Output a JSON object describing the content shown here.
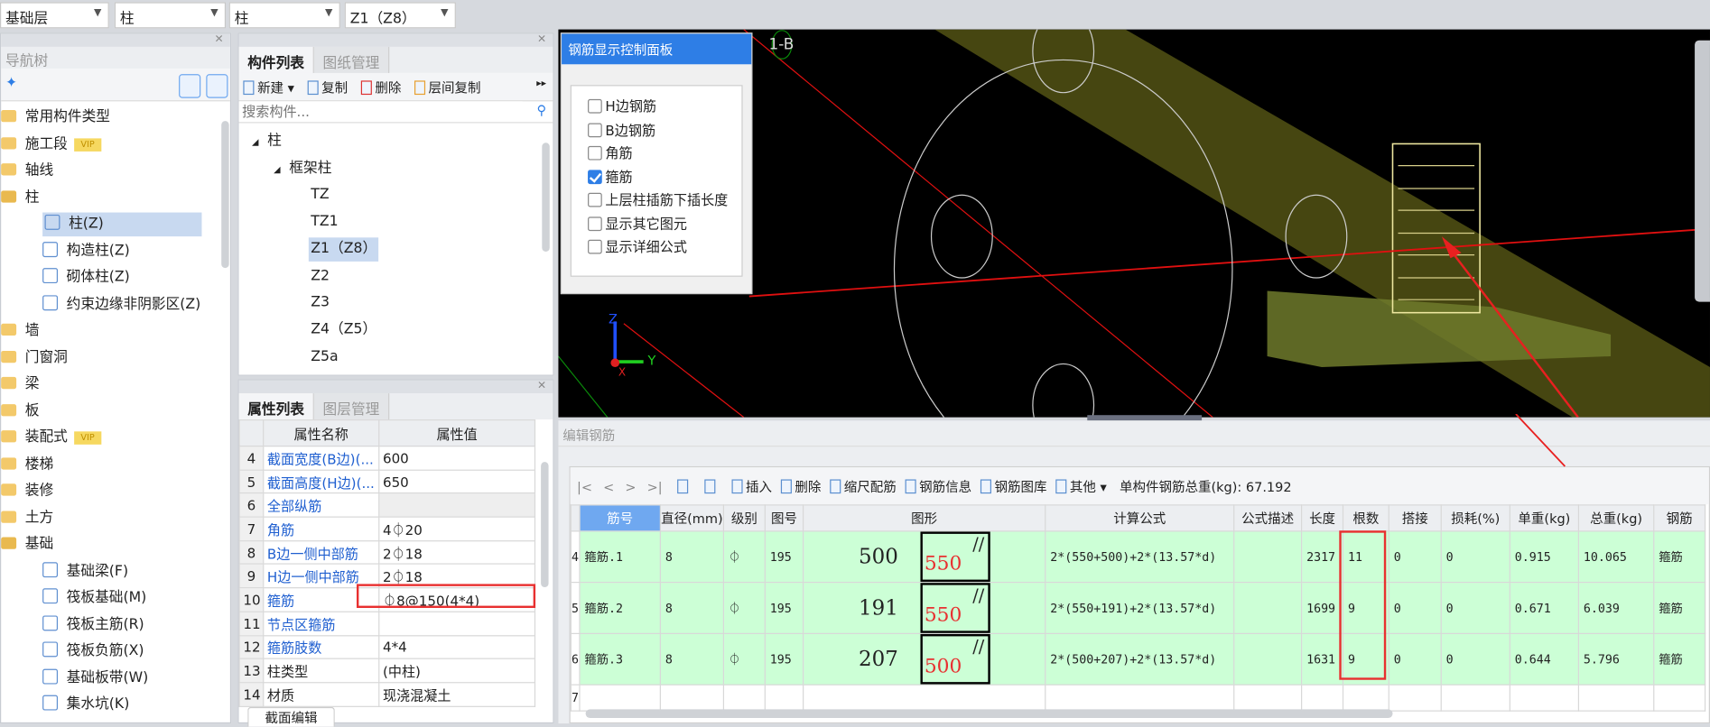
{
  "topbar": {
    "dropdowns": [
      "基础层",
      "柱",
      "柱",
      "Z1（Z8）"
    ]
  },
  "nav": {
    "title": "导航树",
    "items": [
      {
        "label": "常用构件类型",
        "type": "folder"
      },
      {
        "label": "施工段",
        "type": "folder",
        "badge": "VIP"
      },
      {
        "label": "轴线",
        "type": "folder"
      },
      {
        "label": "柱",
        "type": "folder-open"
      },
      {
        "label": "柱(Z)",
        "type": "child",
        "selected": true
      },
      {
        "label": "构造柱(Z)",
        "type": "child"
      },
      {
        "label": "砌体柱(Z)",
        "type": "child"
      },
      {
        "label": "约束边缘非阴影区(Z)",
        "type": "child"
      },
      {
        "label": "墙",
        "type": "folder"
      },
      {
        "label": "门窗洞",
        "type": "folder"
      },
      {
        "label": "梁",
        "type": "folder"
      },
      {
        "label": "板",
        "type": "folder"
      },
      {
        "label": "装配式",
        "type": "folder",
        "badge": "VIP"
      },
      {
        "label": "楼梯",
        "type": "folder"
      },
      {
        "label": "装修",
        "type": "folder"
      },
      {
        "label": "土方",
        "type": "folder"
      },
      {
        "label": "基础",
        "type": "folder-open"
      },
      {
        "label": "基础梁(F)",
        "type": "child"
      },
      {
        "label": "筏板基础(M)",
        "type": "child"
      },
      {
        "label": "筏板主筋(R)",
        "type": "child"
      },
      {
        "label": "筏板负筋(X)",
        "type": "child"
      },
      {
        "label": "基础板带(W)",
        "type": "child"
      },
      {
        "label": "集水坑(K)",
        "type": "child"
      }
    ]
  },
  "components": {
    "tabs": [
      "构件列表",
      "图纸管理"
    ],
    "toolbar": [
      "新建",
      "复制",
      "删除",
      "层间复制"
    ],
    "search_placeholder": "搜索构件...",
    "tree": [
      {
        "label": "柱",
        "level": 0
      },
      {
        "label": "框架柱",
        "level": 1
      },
      {
        "label": "TZ",
        "level": 2
      },
      {
        "label": "TZ1",
        "level": 2
      },
      {
        "label": "Z1（Z8）",
        "level": 2,
        "selected": true
      },
      {
        "label": "Z2",
        "level": 2
      },
      {
        "label": "Z3",
        "level": 2
      },
      {
        "label": "Z4（Z5）",
        "level": 2
      },
      {
        "label": "Z5a",
        "level": 2
      }
    ]
  },
  "properties": {
    "tabs": [
      "属性列表",
      "图层管理"
    ],
    "headers": [
      "属性名称",
      "属性值"
    ],
    "rows": [
      [
        "4",
        "截面宽度(B边)(...",
        "600"
      ],
      [
        "5",
        "截面高度(H边)(...",
        "650"
      ],
      [
        "6",
        "全部纵筋",
        ""
      ],
      [
        "7",
        "角筋",
        "4⏀20"
      ],
      [
        "8",
        "B边一侧中部筋",
        "2⏀18"
      ],
      [
        "9",
        "H边一侧中部筋",
        "2⏀18"
      ],
      [
        "10",
        "箍筋",
        "⏀8@150(4*4)"
      ],
      [
        "11",
        "节点区箍筋",
        ""
      ],
      [
        "12",
        "箍筋肢数",
        "4*4"
      ],
      [
        "13",
        "柱类型",
        "(中柱)"
      ],
      [
        "14",
        "材质",
        "现浇混凝土"
      ]
    ],
    "bottom_tab": "截面编辑"
  },
  "control_panel": {
    "title": "钢筋显示控制面板",
    "options": [
      {
        "label": "H边钢筋",
        "checked": false
      },
      {
        "label": "B边钢筋",
        "checked": false
      },
      {
        "label": "角筋",
        "checked": false
      },
      {
        "label": "箍筋",
        "checked": true
      },
      {
        "label": "上层柱插筋下插长度",
        "checked": false
      },
      {
        "label": "显示其它图元",
        "checked": false
      },
      {
        "label": "显示详细公式",
        "checked": false
      }
    ]
  },
  "viewport": {
    "axis_label": "1-B",
    "axes": [
      "Z",
      "Y",
      "X"
    ]
  },
  "rebar_editor": {
    "title": "编辑钢筋",
    "nav": [
      "|<",
      "<",
      ">",
      ">|"
    ],
    "toolbar": [
      "插入",
      "删除",
      "缩尺配筋",
      "钢筋信息",
      "钢筋图库",
      "其他"
    ],
    "total_label": "单构件钢筋总重(kg): 67.192",
    "headers": [
      "筋号",
      "直径(mm)",
      "级别",
      "图号",
      "图形",
      "计算公式",
      "公式描述",
      "长度",
      "根数",
      "搭接",
      "损耗(%)",
      "单重(kg)",
      "总重(kg)",
      "钢筋"
    ],
    "rows": [
      {
        "n": "4",
        "name": "箍筋.1",
        "dia": "8",
        "grade": "⏀",
        "fig": "195",
        "dim1": "500",
        "dim2": "550",
        "formula": "2*(550+500)+2*(13.57*d)",
        "desc": "",
        "len": "2317",
        "count": "11",
        "lap": "0",
        "loss": "0",
        "unit": "0.915",
        "total": "10.065",
        "type": "箍筋"
      },
      {
        "n": "5",
        "name": "箍筋.2",
        "dia": "8",
        "grade": "⏀",
        "fig": "195",
        "dim1": "191",
        "dim2": "550",
        "formula": "2*(550+191)+2*(13.57*d)",
        "desc": "",
        "len": "1699",
        "count": "9",
        "lap": "0",
        "loss": "0",
        "unit": "0.671",
        "total": "6.039",
        "type": "箍筋"
      },
      {
        "n": "6",
        "name": "箍筋.3",
        "dia": "8",
        "grade": "⏀",
        "fig": "195",
        "dim1": "207",
        "dim2": "500",
        "formula": "2*(500+207)+2*(13.57*d)",
        "desc": "",
        "len": "1631",
        "count": "9",
        "lap": "0",
        "loss": "0",
        "unit": "0.644",
        "total": "5.796",
        "type": "箍筋"
      }
    ],
    "empty_row": "7"
  },
  "colors": {
    "accent": "#2e7ee6",
    "highlight": "#e83030",
    "row_bg": "#ccffd6",
    "link": "#1f5fd0"
  }
}
